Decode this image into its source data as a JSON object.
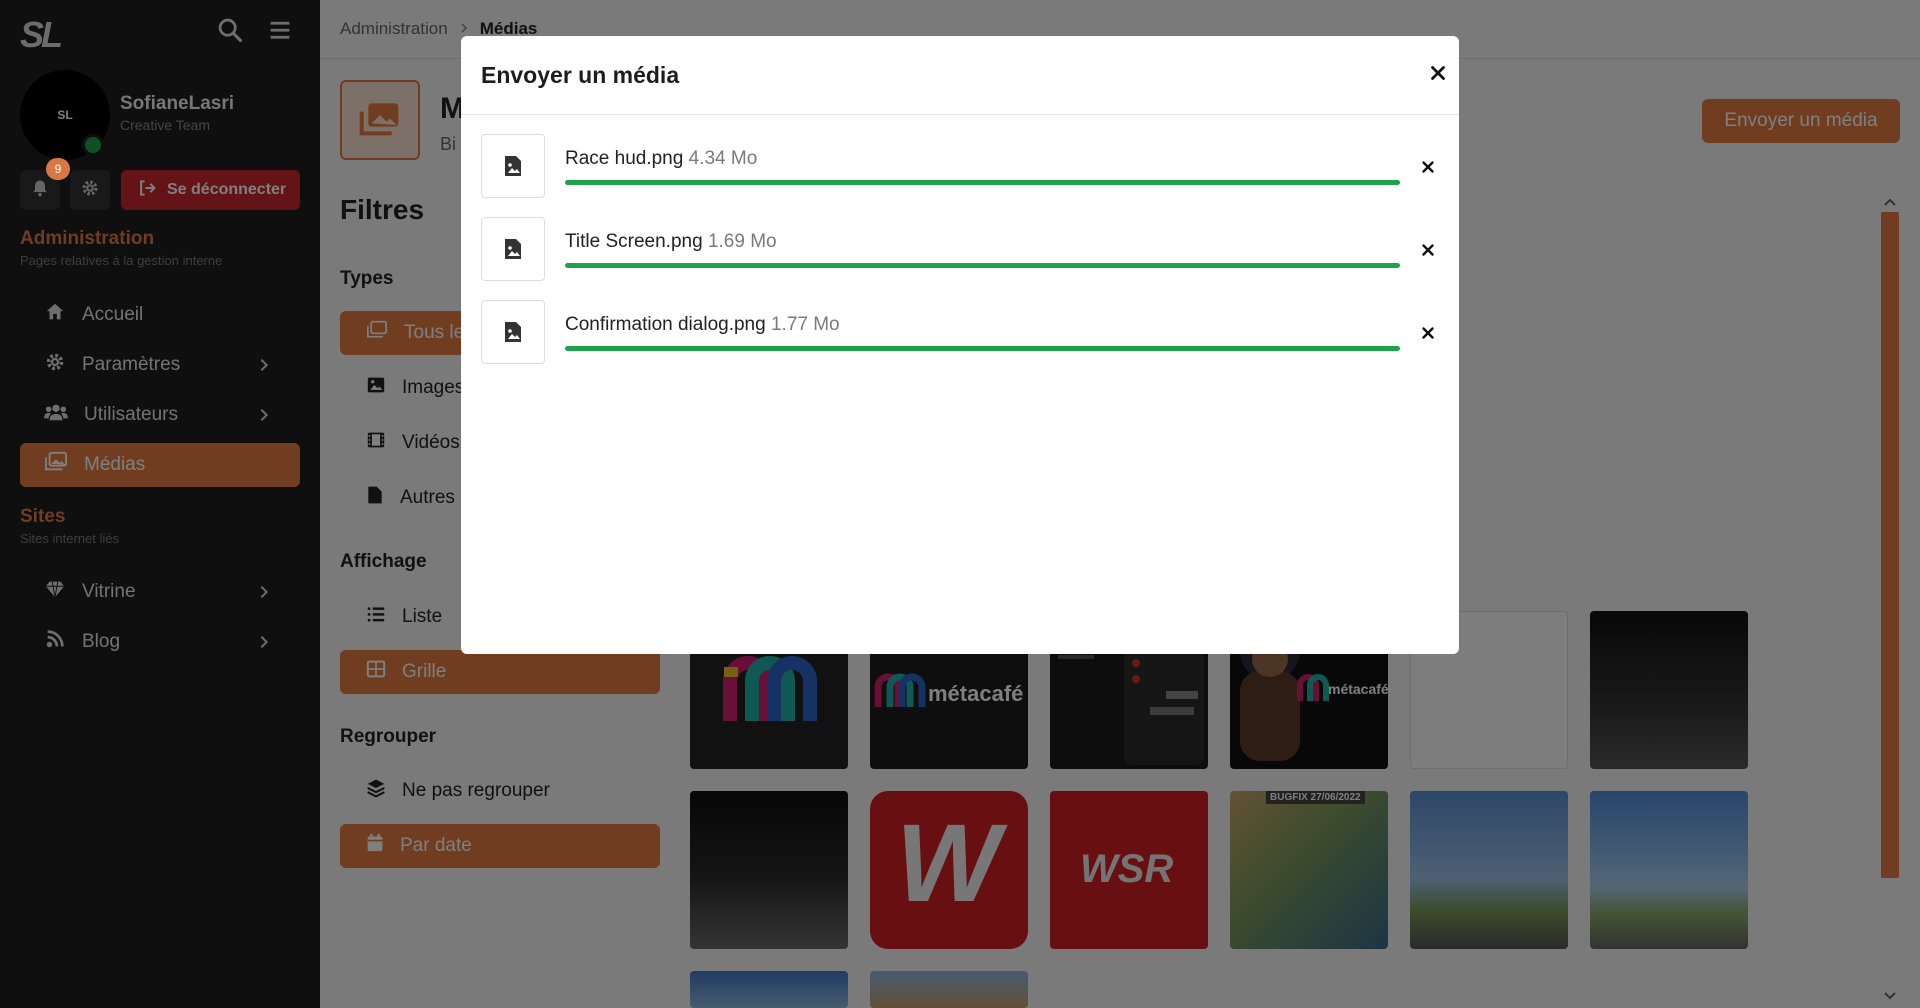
{
  "sidebar": {
    "logo": "SL",
    "avatar_text": "SL",
    "user_name": "SofianeLasri",
    "user_role": "Creative Team",
    "notif_count": "9",
    "logout_label": "Se déconnecter",
    "sections": [
      {
        "title": "Administration",
        "subtitle": "Pages relatives à la gestion interne",
        "items": [
          {
            "label": "Accueil",
            "icon": "home-icon",
            "has_chevron": false,
            "active": false
          },
          {
            "label": "Paramètres",
            "icon": "gear-icon",
            "has_chevron": true,
            "active": false
          },
          {
            "label": "Utilisateurs",
            "icon": "users-icon",
            "has_chevron": true,
            "active": false
          },
          {
            "label": "Médias",
            "icon": "images-icon",
            "has_chevron": false,
            "active": true
          }
        ]
      },
      {
        "title": "Sites",
        "subtitle": "Sites internet liés",
        "items": [
          {
            "label": "Vitrine",
            "icon": "gem-icon",
            "has_chevron": true,
            "active": false
          },
          {
            "label": "Blog",
            "icon": "blog-icon",
            "has_chevron": true,
            "active": false
          }
        ]
      }
    ]
  },
  "breadcrumb": {
    "parent": "Administration",
    "current": "Médias"
  },
  "page": {
    "title_visible": "M",
    "subtitle_visible": "Bi",
    "send_button": "Envoyer un média"
  },
  "filters": {
    "title": "Filtres",
    "types_heading": "Types",
    "types": [
      "Tous le",
      "Images",
      "Vidéos",
      "Autres"
    ],
    "display_heading": "Affichage",
    "display": [
      "Liste",
      "Grille"
    ],
    "group_heading": "Regrouper",
    "group": [
      "Ne pas regrouper",
      "Par date"
    ]
  },
  "thumbnails": [
    {
      "kind": "metacafe-logo"
    },
    {
      "kind": "metacafe-banner",
      "text": "métacafé"
    },
    {
      "kind": "phone-ui"
    },
    {
      "kind": "metacafe-person",
      "text": "métacafé"
    },
    {
      "kind": "blank"
    },
    {
      "kind": "dark-garage"
    },
    {
      "kind": "parking"
    },
    {
      "kind": "w-logo",
      "text": "W"
    },
    {
      "kind": "wsr-logo",
      "text": "WSR"
    },
    {
      "kind": "star-island",
      "text": "BUGFIX 27/06/2022"
    },
    {
      "kind": "palms-a"
    },
    {
      "kind": "palms-b"
    },
    {
      "kind": "sky"
    },
    {
      "kind": "building"
    }
  ],
  "modal": {
    "title": "Envoyer un média",
    "uploads": [
      {
        "name": "Race hud.png",
        "size": "4.34 Mo",
        "progress": 1.0
      },
      {
        "name": "Title Screen.png",
        "size": "1.69 Mo",
        "progress": 1.0
      },
      {
        "name": "Confirmation dialog.png",
        "size": "1.77 Mo",
        "progress": 1.0
      }
    ]
  },
  "colors": {
    "accent": "#e07b43",
    "danger": "#c9262e",
    "success": "#1fa34a",
    "sidebar": "#1e1e1e"
  }
}
